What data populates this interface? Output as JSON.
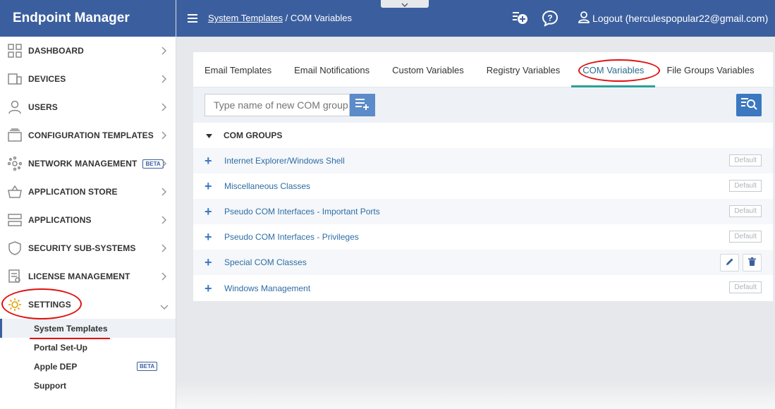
{
  "app": {
    "title": "Endpoint Manager"
  },
  "sidebar": {
    "items": [
      {
        "label": "DASHBOARD",
        "icon": "dashboard-icon"
      },
      {
        "label": "DEVICES",
        "icon": "devices-icon"
      },
      {
        "label": "USERS",
        "icon": "user-icon"
      },
      {
        "label": "CONFIGURATION TEMPLATES",
        "icon": "templates-icon"
      },
      {
        "label": "NETWORK MANAGEMENT",
        "icon": "network-icon",
        "badge": "BETA"
      },
      {
        "label": "APPLICATION STORE",
        "icon": "basket-icon"
      },
      {
        "label": "APPLICATIONS",
        "icon": "applications-icon"
      },
      {
        "label": "SECURITY SUB-SYSTEMS",
        "icon": "shield-icon"
      },
      {
        "label": "LICENSE MANAGEMENT",
        "icon": "license-icon"
      },
      {
        "label": "SETTINGS",
        "icon": "gear-icon"
      }
    ],
    "settings_sub": [
      {
        "label": "System Templates"
      },
      {
        "label": "Portal Set-Up"
      },
      {
        "label": "Apple DEP",
        "badge": "BETA"
      },
      {
        "label": "Support"
      }
    ]
  },
  "header": {
    "breadcrumb_parent": "System Templates",
    "breadcrumb_sep": "/",
    "breadcrumb_current": "COM Variables",
    "logout_label": "Logout (herculespopular22@gmail.com)"
  },
  "tabs": [
    {
      "label": "Email Templates"
    },
    {
      "label": "Email Notifications"
    },
    {
      "label": "Custom Variables"
    },
    {
      "label": "Registry Variables"
    },
    {
      "label": "COM Variables"
    },
    {
      "label": "File Groups Variables"
    }
  ],
  "toolbar": {
    "input_placeholder": "Type name of new COM group"
  },
  "groups": {
    "header": "COM GROUPS",
    "rows": [
      {
        "name": "Internet Explorer/Windows Shell",
        "badge": "Default"
      },
      {
        "name": "Miscellaneous Classes",
        "badge": "Default"
      },
      {
        "name": "Pseudo COM Interfaces - Important Ports",
        "badge": "Default"
      },
      {
        "name": "Pseudo COM Interfaces - Privileges",
        "badge": "Default"
      },
      {
        "name": "Special COM Classes",
        "badge": ""
      },
      {
        "name": "Windows Management",
        "badge": "Default"
      }
    ]
  },
  "colors": {
    "brand": "#3b5f9e",
    "accent": "#2aa198",
    "link": "#2e6da4",
    "highlight": "#e01010"
  }
}
